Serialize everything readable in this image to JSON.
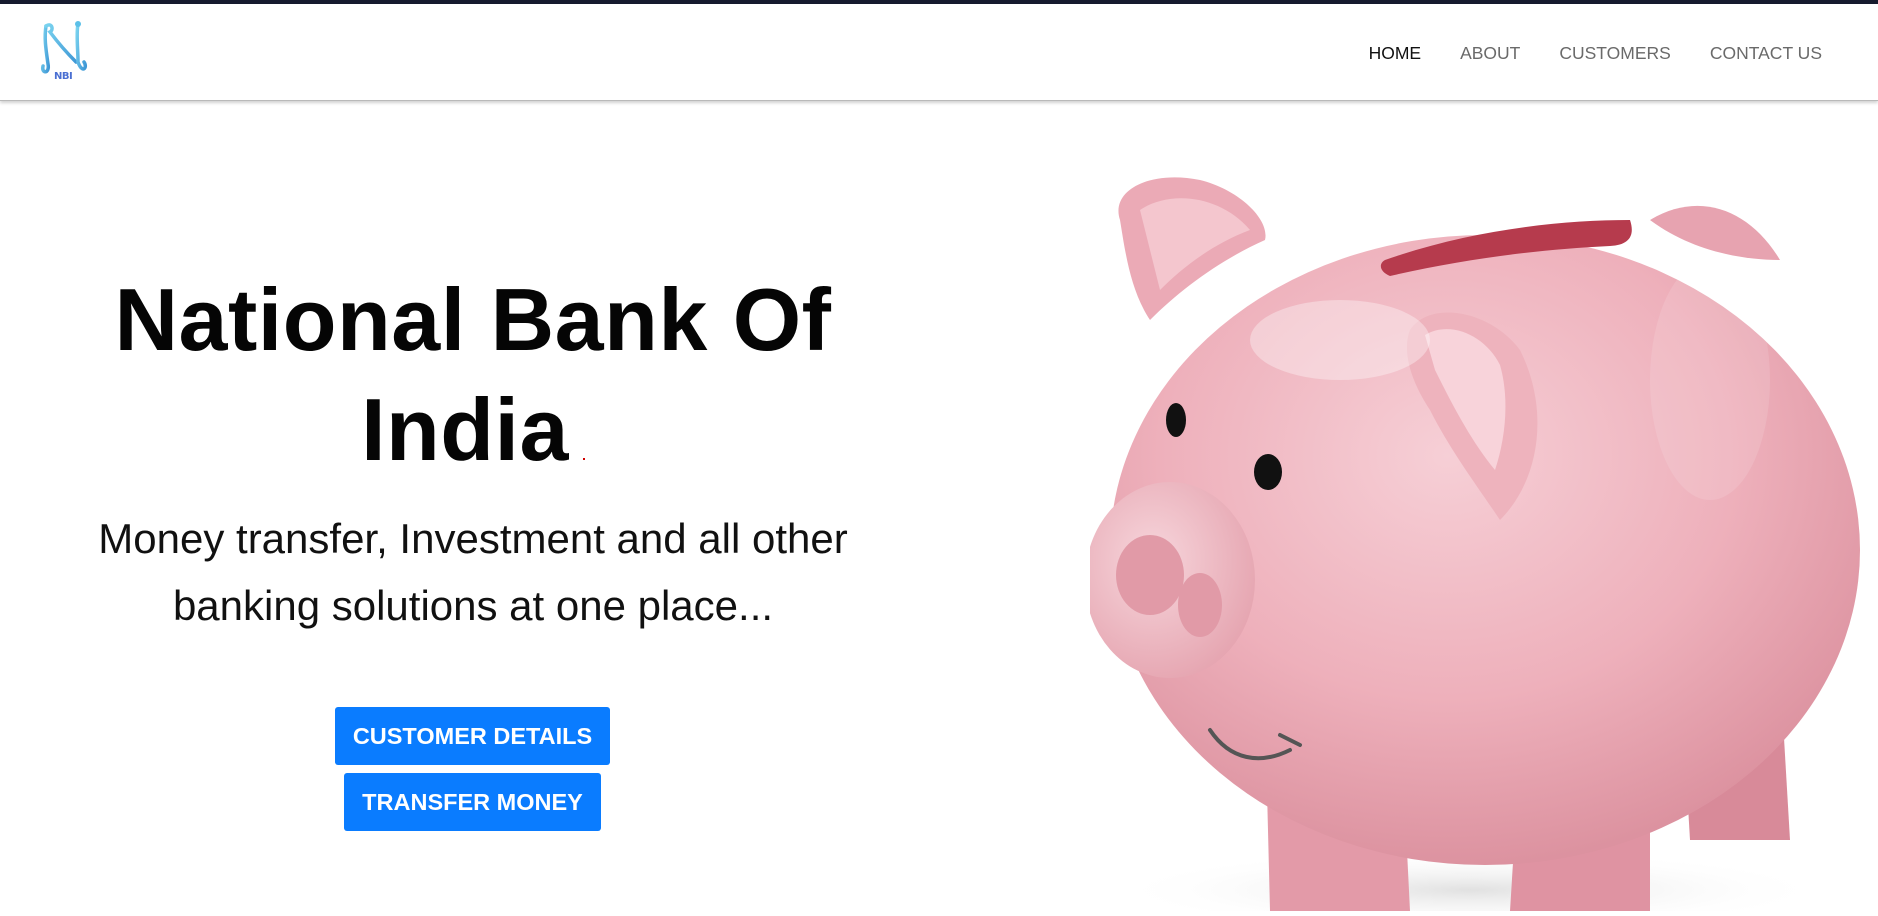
{
  "header": {
    "logo_icon": "nbi-logo-icon",
    "logo_text": "NBI",
    "nav": [
      {
        "label": "HOME",
        "active": true
      },
      {
        "label": "ABOUT",
        "active": false
      },
      {
        "label": "CUSTOMERS",
        "active": false
      },
      {
        "label": "CONTACT US",
        "active": false
      }
    ]
  },
  "hero": {
    "title_line1": "National Bank Of",
    "title_line2": "India",
    "subtitle_line1": "Money transfer, Investment and all other",
    "subtitle_line2": "banking solutions at one place...",
    "customer_button": "CUSTOMER DETAILS",
    "transfer_button": "TRANSFER MONEY",
    "image_icon": "piggy-bank-image"
  },
  "colors": {
    "accent": "#0a7cff",
    "top_strip": "#161b2e",
    "piggy_pink": "#eeaeb9",
    "logo_blue": "#5bc0e8"
  }
}
